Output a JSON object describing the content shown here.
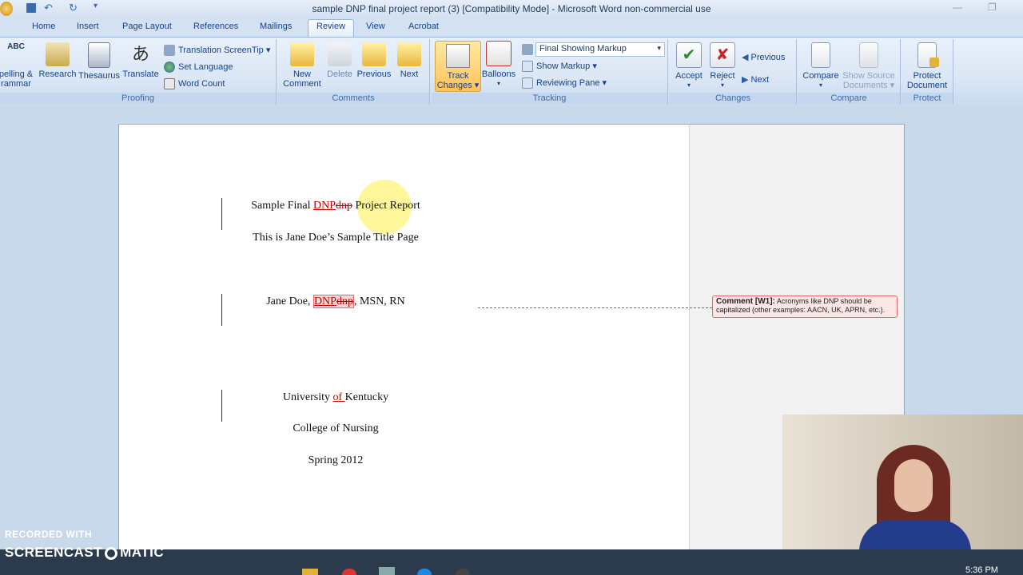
{
  "window": {
    "title": "sample DNP final project report (3) [Compatibility Mode] - Microsoft Word non-commercial use"
  },
  "tabs": [
    "Home",
    "Insert",
    "Page Layout",
    "References",
    "Mailings",
    "Review",
    "View",
    "Acrobat"
  ],
  "ribbon": {
    "proofing": {
      "name": "Proofing",
      "spelling_line1": "pelling &",
      "spelling_line2": "rammar",
      "spelling_abc": "ABC",
      "research": "Research",
      "thesaurus": "Thesaurus",
      "translate": "Translate",
      "translation_screentip": "Translation ScreenTip",
      "set_language": "Set Language",
      "word_count": "Word Count"
    },
    "comments": {
      "name": "Comments",
      "new_line1": "New",
      "new_line2": "Comment",
      "delete": "Delete",
      "previous": "Previous",
      "next": "Next"
    },
    "tracking": {
      "name": "Tracking",
      "track_line1": "Track",
      "track_line2": "Changes",
      "balloons": "Balloons",
      "final_showing_markup": "Final Showing Markup",
      "show_markup": "Show Markup",
      "reviewing_pane": "Reviewing Pane"
    },
    "changes": {
      "name": "Changes",
      "accept": "Accept",
      "reject": "Reject",
      "previous": "Previous",
      "next": "Next"
    },
    "compare": {
      "name": "Compare",
      "compare": "Compare",
      "show_source_line1": "Show Source",
      "show_source_line2": "Documents"
    },
    "protect": {
      "name": "Protect",
      "protect_line1": "Protect",
      "protect_line2": "Document"
    }
  },
  "document": {
    "title_pre": "Sample Final ",
    "title_ins": "DNP",
    "title_del": "dnp",
    "title_post": " Project Report",
    "subtitle": "This is Jane Doe’s Sample Title Page",
    "author_pre": "Jane Doe, ",
    "author_ins": "DNP",
    "author_del": "dnp",
    "author_post": ", MSN, RN",
    "univ_pre": "University ",
    "univ_ins": "of ",
    "univ_post": "Kentucky",
    "college": "College of Nursing",
    "term": "Spring 2012"
  },
  "comment": {
    "label": "Comment [W1]:",
    "text": " Acronyms like DNP should be capitalized (other examples: AACN, UK, APRN, etc.)."
  },
  "overlay": {
    "recorded_with": "RECORDED WITH",
    "screencast_left": "SCREENCAST",
    "screencast_right": "MATIC",
    "clock": "5:36 PM"
  }
}
